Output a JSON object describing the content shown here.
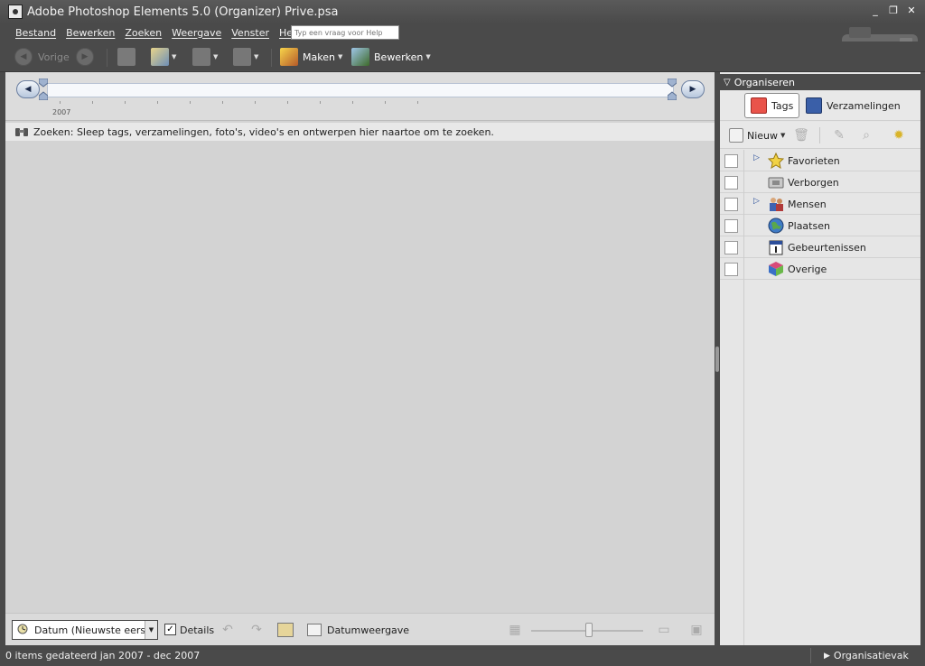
{
  "window": {
    "title": "Adobe Photoshop Elements 5.0 (Organizer)   Prive.psa",
    "controls": [
      "_",
      "❐",
      "✕"
    ]
  },
  "menu": {
    "items": [
      "Bestand",
      "Bewerken",
      "Zoeken",
      "Weergave",
      "Venster",
      "Help"
    ],
    "help_placeholder": "Typ een vraag voor Help"
  },
  "toolbar": {
    "back_label": "Vorige",
    "create_label": "Maken",
    "edit_label": "Bewerken"
  },
  "timeline": {
    "year": "2007"
  },
  "search_hint": "Zoeken: Sleep tags, verzamelingen, foto's, video's en ontwerpen hier naartoe om te zoeken.",
  "bottom": {
    "sort_value": "Datum (Nieuwste eerst)",
    "details_label": "Details",
    "details_checked": true,
    "date_view_label": "Datumweergave"
  },
  "panel": {
    "header": "Organiseren",
    "tabs": [
      {
        "label": "Tags",
        "active": true
      },
      {
        "label": "Verzamelingen",
        "active": false
      }
    ],
    "new_label": "Nieuw",
    "tags": [
      {
        "label": "Favorieten",
        "expandable": true,
        "icon": "star-icon"
      },
      {
        "label": "Verborgen",
        "expandable": false,
        "icon": "hidden-icon"
      },
      {
        "label": "Mensen",
        "expandable": true,
        "icon": "people-icon"
      },
      {
        "label": "Plaatsen",
        "expandable": false,
        "icon": "globe-icon"
      },
      {
        "label": "Gebeurtenissen",
        "expandable": false,
        "icon": "calendar-icon"
      },
      {
        "label": "Overige",
        "expandable": false,
        "icon": "cube-icon"
      }
    ]
  },
  "status": {
    "left": "0 items gedateerd jan 2007 - dec 2007",
    "right": "Organisatievak"
  },
  "colors": {
    "chrome": "#4a4a4a",
    "workspace": "#d3d3d3",
    "panel": "#e6e6e6",
    "timeline_accent": "#7f8fa8"
  }
}
